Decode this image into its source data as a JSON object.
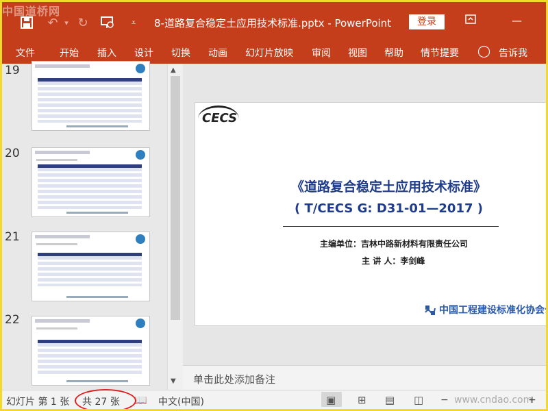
{
  "watermark_top": "中国道桥网",
  "watermark_bottom": "www.cndao.com",
  "titlebar": {
    "doc_title": "8-道路复合稳定土应用技术标准.pptx  -  PowerPoint",
    "login": "登录",
    "icons": [
      "save-icon",
      "undo-icon",
      "redo-icon",
      "slideshow-icon",
      "customize-qat-icon",
      "ribbon-display-icon",
      "minimize-icon"
    ]
  },
  "ribbon": {
    "tabs": [
      "文件",
      "开始",
      "插入",
      "设计",
      "切换",
      "动画",
      "幻灯片放映",
      "审阅",
      "视图",
      "帮助",
      "情节提要"
    ],
    "tell_me": "告诉我"
  },
  "thumbnails": [
    {
      "number": "19"
    },
    {
      "number": "20"
    },
    {
      "number": "21"
    },
    {
      "number": "22"
    }
  ],
  "slide": {
    "logo_text": "CECS",
    "title": "《道路复合稳定土应用技术标准》",
    "code": "( T/CECS G: D31-01—2017 )",
    "editor_label": "主编单位：吉林中路新材料有限责任公司",
    "speaker_label": "主  讲  人：李剑峰",
    "org": "中国工程建设标准化协会公"
  },
  "notes_placeholder": "单击此处添加备注",
  "status": {
    "slide_pos": "幻灯片 第 1 张",
    "slide_total": "共 27 张",
    "language": "中文(中国)",
    "zoom_minus": "−"
  }
}
